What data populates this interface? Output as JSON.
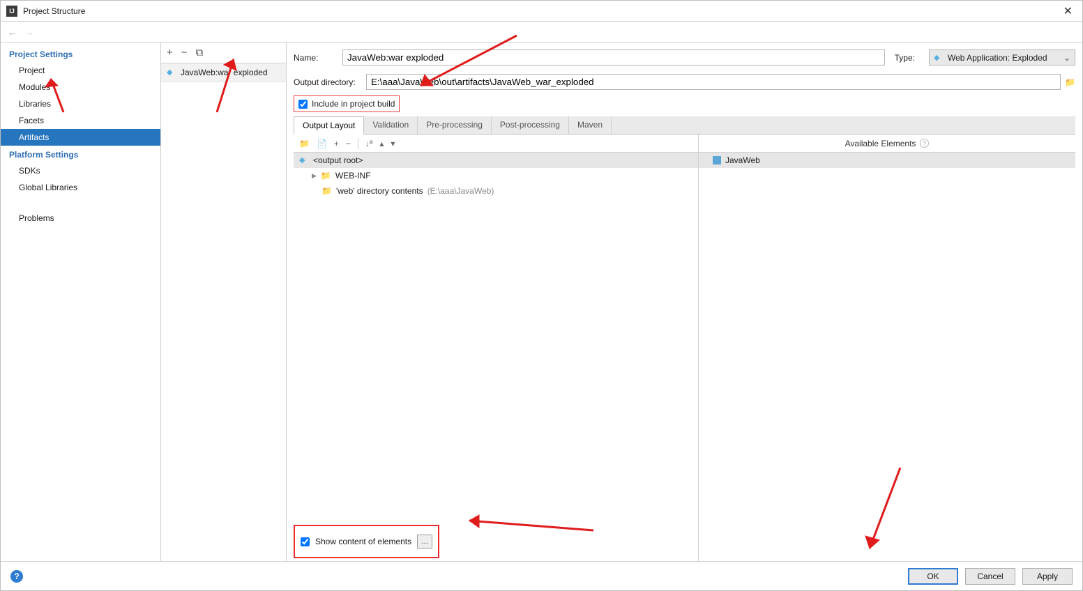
{
  "window": {
    "title": "Project Structure"
  },
  "sidebar": {
    "section1_title": "Project Settings",
    "items1": [
      "Project",
      "Modules",
      "Libraries",
      "Facets",
      "Artifacts"
    ],
    "section2_title": "Platform Settings",
    "items2": [
      "SDKs",
      "Global Libraries"
    ],
    "problems": "Problems"
  },
  "midlist": {
    "item": "JavaWeb:war exploded"
  },
  "form": {
    "name_label": "Name:",
    "name_value": "JavaWeb:war exploded",
    "type_label": "Type:",
    "type_value": "Web Application: Exploded",
    "outdir_label": "Output directory:",
    "outdir_value": "E:\\aaa\\JavaWeb\\out\\artifacts\\JavaWeb_war_exploded",
    "include_label": "Include in project build"
  },
  "tabs": [
    "Output Layout",
    "Validation",
    "Pre-processing",
    "Post-processing",
    "Maven"
  ],
  "layout_tree": {
    "root": "<output root>",
    "webinf": "WEB-INF",
    "webdir": "'web' directory contents",
    "webdir_path": "(E:\\aaa\\JavaWeb)"
  },
  "available": {
    "header": "Available Elements",
    "module": "JavaWeb"
  },
  "show_elements_label": "Show content of elements",
  "buttons": {
    "ok": "OK",
    "cancel": "Cancel",
    "apply": "Apply"
  }
}
